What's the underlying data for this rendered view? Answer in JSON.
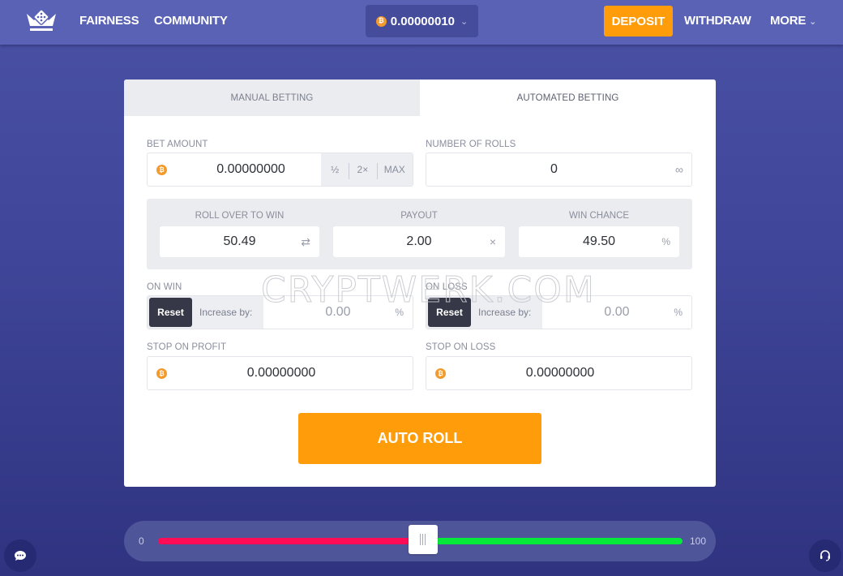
{
  "header": {
    "logo_icon": "crown-dice-icon",
    "nav": [
      {
        "label": "FAIRNESS"
      },
      {
        "label": "COMMUNITY"
      }
    ],
    "balance": {
      "currency_icon": "bitcoin-icon",
      "value": "0.00000010",
      "dropdown_icon": "chevron-down-icon"
    },
    "deposit_label": "DEPOSIT",
    "withdraw_label": "WITHDRAW",
    "more_label": "MORE",
    "more_icon": "chevron-down-icon"
  },
  "tabs": [
    {
      "label": "MANUAL BETTING",
      "active": false
    },
    {
      "label": "AUTOMATED BETTING",
      "active": true
    }
  ],
  "form": {
    "bet_amount": {
      "label": "BET AMOUNT",
      "value": "0.00000000",
      "buttons": [
        "½",
        "2×",
        "MAX"
      ]
    },
    "number_of_rolls": {
      "label": "NUMBER OF ROLLS",
      "value": "0",
      "suffix": "∞"
    },
    "roll_over": {
      "label": "ROLL OVER TO WIN",
      "value": "50.49",
      "suffix": "⇄"
    },
    "payout": {
      "label": "PAYOUT",
      "value": "2.00",
      "suffix": "×"
    },
    "win_chance": {
      "label": "WIN CHANCE",
      "value": "49.50",
      "suffix": "%"
    },
    "on_win": {
      "label": "ON WIN",
      "reset_label": "Reset",
      "increase_label": "Increase by:",
      "value": "0.00",
      "suffix": "%"
    },
    "on_loss": {
      "label": "ON LOSS",
      "reset_label": "Reset",
      "increase_label": "Increase by:",
      "value": "0.00",
      "suffix": "%"
    },
    "stop_on_profit": {
      "label": "STOP ON PROFIT",
      "value": "0.00000000"
    },
    "stop_on_loss": {
      "label": "STOP ON LOSS",
      "value": "0.00000000"
    },
    "auto_roll_label": "AUTO ROLL"
  },
  "slider": {
    "min_label": "0",
    "max_label": "100",
    "value": 50.49,
    "min": 0,
    "max": 100,
    "lose_color": "#ff0b56",
    "win_color": "#06e83a"
  },
  "watermark": "CRYPTWERK.COM",
  "colors": {
    "accent": "#ff9c0a",
    "header": "#5a62b6",
    "bitcoin": "#f29a2e"
  }
}
